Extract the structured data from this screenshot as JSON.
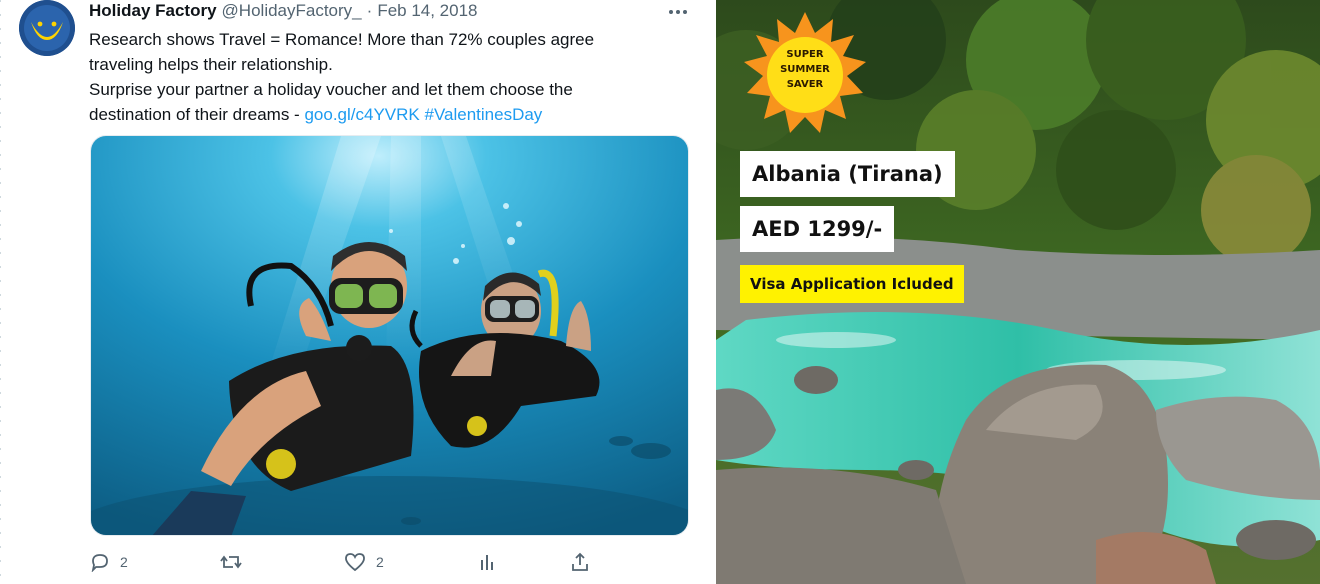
{
  "tweet": {
    "display_name": "Holiday Factory",
    "handle": "@HolidayFactory_",
    "separator": "·",
    "date": "Feb 14, 2018",
    "text_line1": "Research shows Travel = Romance! More than 72% couples agree",
    "text_line2": "traveling helps their relationship.",
    "text_line3": "Surprise your partner a holiday voucher and let them choose the",
    "text_line4_plain": "destination of their dreams -",
    "link_url": "goo.gl/c4YVRK",
    "hashtag": "#ValentinesDay",
    "actions": {
      "reply_count": "2",
      "retweet_count": "",
      "like_count": "2"
    },
    "media_icon": "scuba-divers-photo"
  },
  "promo": {
    "badge_lines": [
      "SUPER",
      "SUMMER",
      "SAVER"
    ],
    "destination": "Albania (Tirana)",
    "price": "AED 1299/-",
    "visa_note": "Visa Application Icluded",
    "colors": {
      "badge_orange": "#f7941d",
      "badge_yellow": "#ffde17",
      "visa_yellow": "#fff200",
      "river_teal": "#2fbfa7"
    }
  },
  "colors": {
    "link_blue": "#1d9bf0",
    "meta_gray": "#536471",
    "avatar_blue": "#1f4f8f",
    "moon_yellow": "#ffd400"
  }
}
